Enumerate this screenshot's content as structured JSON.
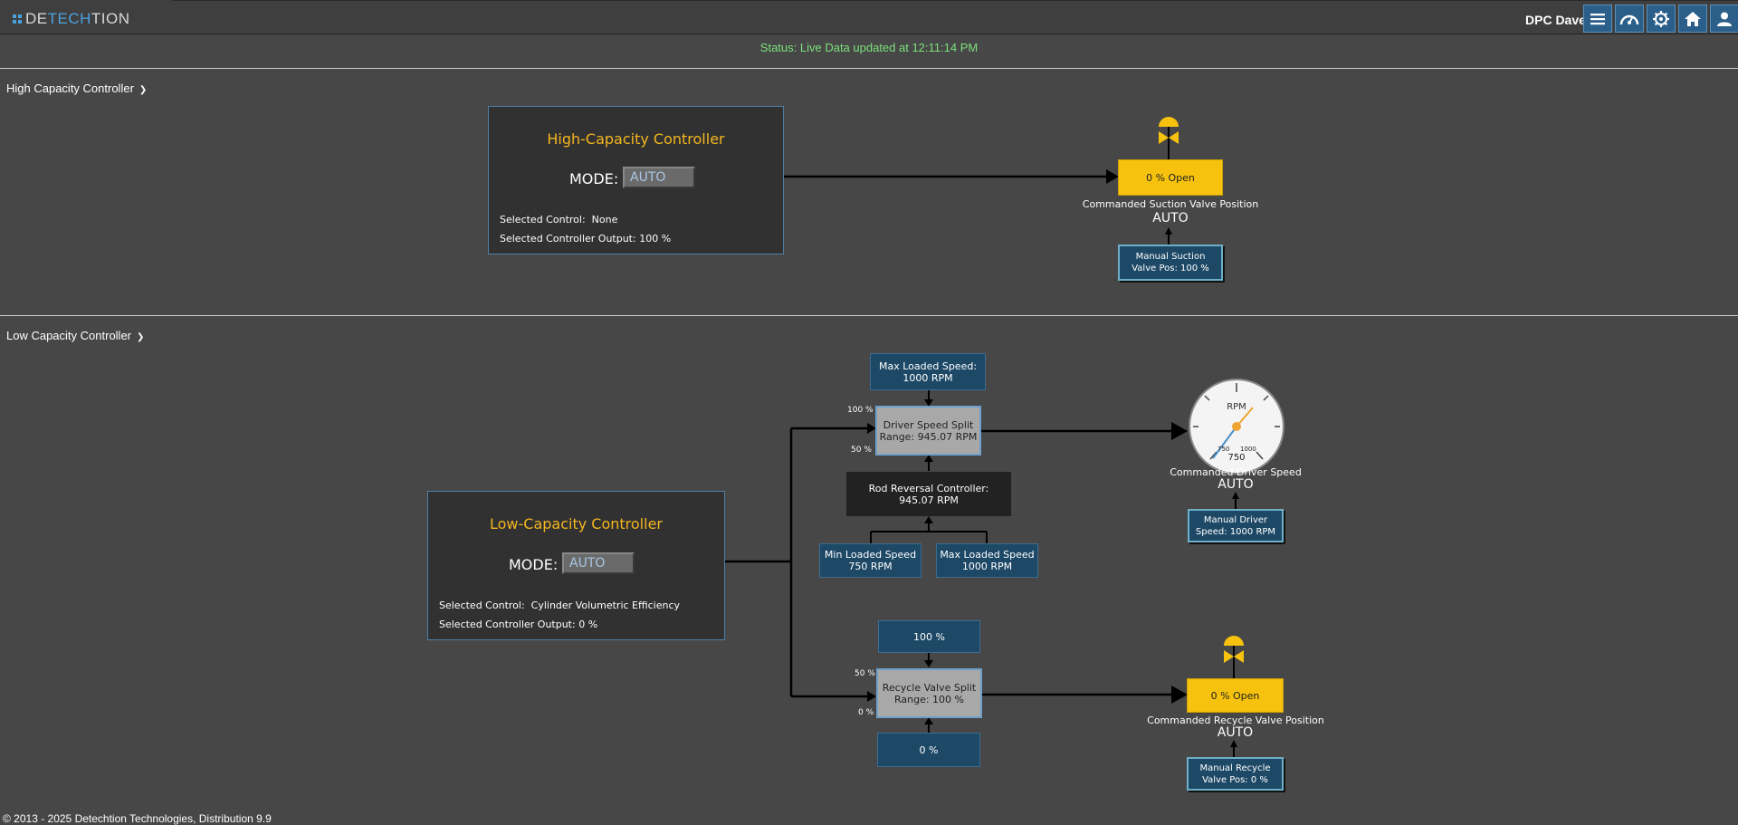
{
  "header": {
    "logo_prefix": "DE",
    "logo_tech": "TECH",
    "logo_suffix": "TION",
    "user": "DPC Dave",
    "nav_icons": [
      "menu-icon",
      "dashboard-icon",
      "settings-icon",
      "home-icon",
      "user-icon"
    ]
  },
  "status": "Status: Live Data updated at 12:11:14 PM",
  "high": {
    "section_title": "High Capacity Controller",
    "panel_title": "High-Capacity Controller",
    "mode_label": "MODE:",
    "mode_value": "AUTO",
    "selected_control_label": "Selected Control:",
    "selected_control_value": "None",
    "output_label": "Selected Controller Output:",
    "output_value": "100 %",
    "valve_box": "0 % Open",
    "valve_label": "Commanded Suction Valve Position",
    "valve_mode": "AUTO",
    "manual_line1": "Manual Suction",
    "manual_line2": "Valve Pos: 100 %"
  },
  "low": {
    "section_title": "Low Capacity Controller",
    "panel_title": "Low-Capacity Controller",
    "mode_label": "MODE:",
    "mode_value": "AUTO",
    "selected_control_label": "Selected Control:",
    "selected_control_value": "Cylinder Volumetric Efficiency",
    "output_label": "Selected Controller Output:",
    "output_value": "0 %",
    "max_loaded_top_line1": "Max Loaded Speed:",
    "max_loaded_top_line2": "1000 RPM",
    "speed_split_line1": "Driver Speed Split",
    "speed_split_line2": "Range: 945.07 RPM",
    "speed_split_hi": "100 %",
    "speed_split_lo": "50 %",
    "rod_line1": "Rod Reversal Controller:",
    "rod_line2": "945.07 RPM",
    "min_loaded_line1": "Min Loaded Speed",
    "min_loaded_line2": "750 RPM",
    "max_loaded_line1": "Max Loaded Speed",
    "max_loaded_line2": "1000 RPM",
    "gauge_unit": "RPM",
    "gauge_min_tick": "750",
    "gauge_max_tick": "1000",
    "gauge_value": "750",
    "driver_label": "Commanded Driver Speed",
    "driver_mode": "AUTO",
    "manual_driver_line1": "Manual Driver",
    "manual_driver_line2": "Speed: 1000 RPM",
    "recycle_top": "100 %",
    "recycle_split_line1": "Recycle Valve Split",
    "recycle_split_line2": "Range: 100 %",
    "recycle_hi": "50 %",
    "recycle_lo": "0 %",
    "recycle_bottom": "0 %",
    "recycle_valve_box": "0 % Open",
    "recycle_valve_label": "Commanded Recycle Valve Position",
    "recycle_valve_mode": "AUTO",
    "manual_recycle_line1": "Manual Recycle",
    "manual_recycle_line2": "Valve Pos: 0 %"
  },
  "footer": "© 2013 - 2025 Detechtion Technologies, Distribution 9.9",
  "colors": {
    "accent_title": "#f3b61f",
    "status_green": "#7be07b",
    "valve_yellow": "#f6c20e",
    "box_blue": "#1d4866"
  }
}
